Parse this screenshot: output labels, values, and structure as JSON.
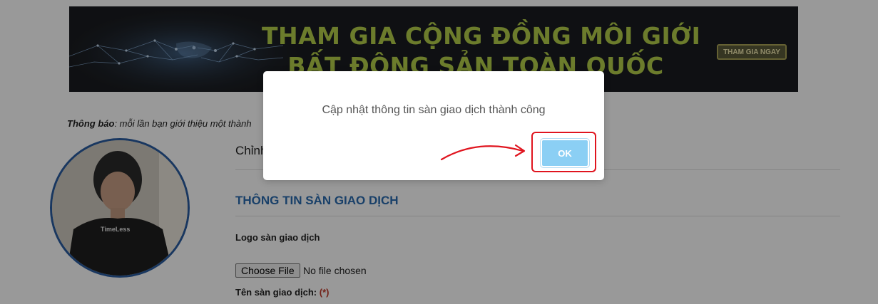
{
  "banner": {
    "line1": "THAM GIA CỘNG ĐỒNG MÔI GIỚI",
    "line2": "BẤT ĐỘNG SẢN TOÀN QUỐC",
    "cta_label": "THAM GIA NGAY",
    "text_color": "#b5cf4a"
  },
  "notice": {
    "label": "Thông báo",
    "text": ": mỗi lần bạn giới thiệu một thành"
  },
  "profile": {
    "avatar_shirt_text": "TimeLess",
    "border_color": "#2a5da0"
  },
  "main": {
    "page_title_partial": "Chỉnh",
    "section_title": "THÔNG TIN SÀN GIAO DỊCH",
    "section_color": "#2a6cb0",
    "logo_label": "Logo sàn giao dịch",
    "file_button_label": "Choose File",
    "file_status": "No file chosen",
    "name_label": "Tên sàn giao dịch:",
    "required_marker": "(*)"
  },
  "modal": {
    "message": "Cập nhật thông tin sàn giao dịch thành công",
    "ok_label": "OK",
    "ok_color": "#8bcff4",
    "highlight_color": "#e0141e"
  },
  "icons": {
    "annotation_arrow": "curved-arrow-icon"
  }
}
